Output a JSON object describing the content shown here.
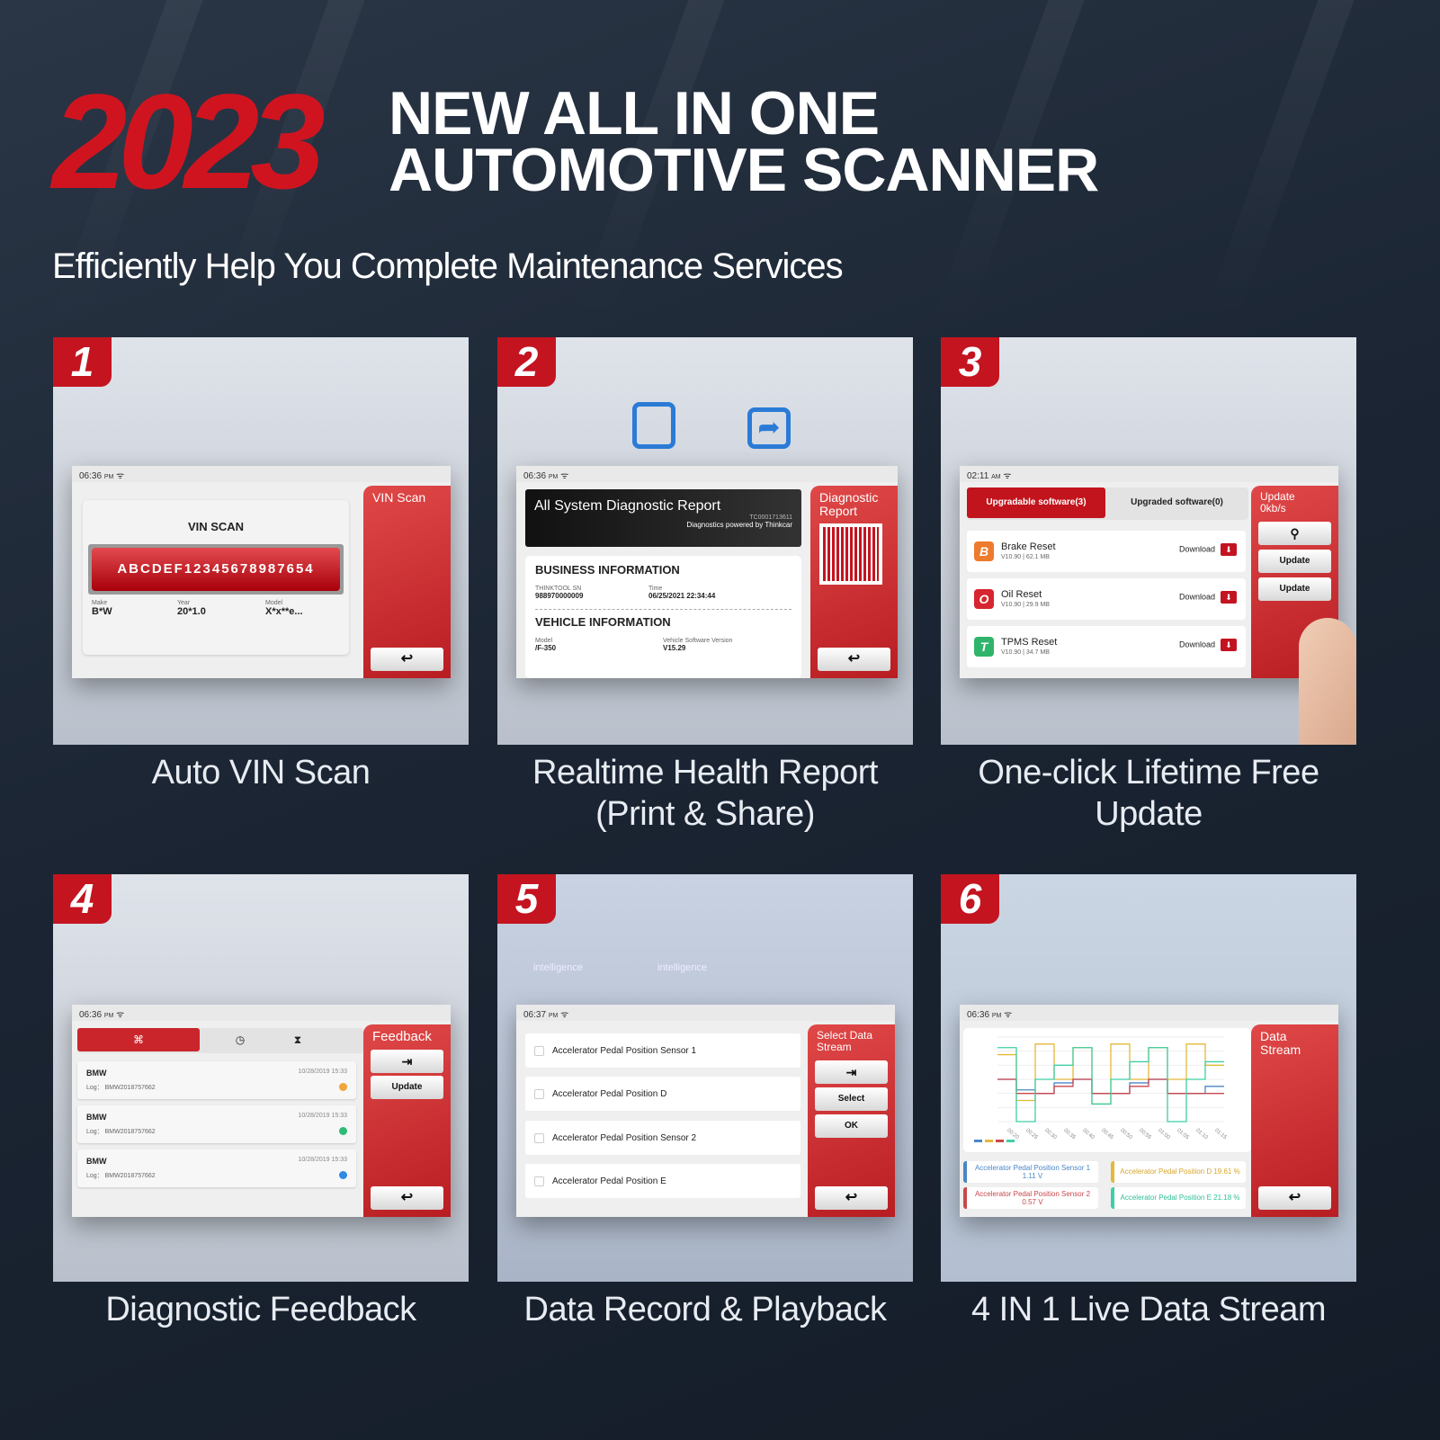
{
  "header": {
    "year": "2023",
    "line1": "NEW ALL IN ONE",
    "line2": "AUTOMOTIVE SCANNER",
    "subtitle": "Efficiently Help You Complete Maintenance Services"
  },
  "colors": {
    "brand_red": "#c41420",
    "background": "#1b2533"
  },
  "features": [
    {
      "number": "1",
      "caption": "Auto VIN Scan"
    },
    {
      "number": "2",
      "caption_line1": "Realtime Health Report",
      "caption_line2": "(Print & Share)"
    },
    {
      "number": "3",
      "caption_line1": "One-click Lifetime Free",
      "caption_line2": "Update"
    },
    {
      "number": "4",
      "caption": "Diagnostic Feedback"
    },
    {
      "number": "5",
      "caption": "Data Record & Playback"
    },
    {
      "number": "6",
      "caption": "4 IN 1 Live Data Stream"
    }
  ],
  "screen1": {
    "time": "06:36",
    "ampm": "PM",
    "title": "VIN SCAN",
    "vin": "ABCDEF12345678987654",
    "make_label": "Make",
    "make": "B*W",
    "year_label": "Year",
    "year": "20*1.0",
    "model_label": "Model",
    "model": "X*x**e...",
    "side_title": "VIN Scan",
    "back_icon": "back-arrow-icon"
  },
  "screen2": {
    "time": "06:36",
    "ampm": "PM",
    "report_title": "All System Diagnostic Report",
    "report_id": "TC0001713611",
    "powered": "Diagnostics powered by Thinkcar",
    "business_heading": "BUSINESS INFORMATION",
    "sn_label": "THINKTOOL SN",
    "sn": "988970000009",
    "time_label": "Time",
    "report_time": "06/25/2021 22:34:44",
    "vehicle_heading": "VEHICLE INFORMATION",
    "model_label": "Model",
    "model": "/F-350",
    "version_label": "Vehicle Software Version",
    "version": "V15.29",
    "side_title": "Diagnostic Report",
    "icons": [
      "printer-icon",
      "share-icon",
      "qr-code-icon"
    ]
  },
  "screen3": {
    "time": "02:11",
    "ampm": "AM",
    "tab_active": "Upgradable software(3)",
    "tab_other": "Upgraded software(0)",
    "side_title": "Update",
    "speed": "0kb/s",
    "search_icon": "search-icon",
    "update_btn": "Update",
    "update_btn2": "Update",
    "items": [
      {
        "letter": "B",
        "name": "Brake Reset",
        "meta": "V10.90 | 62.1 MB",
        "action": "Download",
        "color": "#ee7a2e"
      },
      {
        "letter": "O",
        "name": "Oil Reset",
        "meta": "V10.90 | 29.9 MB",
        "action": "Download",
        "color": "#d6252f"
      },
      {
        "letter": "T",
        "name": "TPMS Reset",
        "meta": "V10.90 | 34.7 MB",
        "action": "Download",
        "color": "#2fb56b"
      }
    ]
  },
  "screen4": {
    "time": "06:36",
    "ampm": "PM",
    "side_title": "Feedback",
    "update_btn": "Update",
    "tabs": [
      "grid-icon",
      "clock-icon",
      "hourglass-icon"
    ],
    "items": [
      {
        "make": "BMW",
        "log": "Log： BMW2018757662",
        "date": "10/28/2019 15:33",
        "status_color": "#f0a53a"
      },
      {
        "make": "BMW",
        "log": "Log： BMW2018757662",
        "date": "10/28/2019 15:33",
        "status_color": "#2dbb78"
      },
      {
        "make": "BMW",
        "log": "Log： BMW2018757662",
        "date": "10/28/2019 15:33",
        "status_color": "#2f8ae5"
      }
    ]
  },
  "screen5": {
    "time": "06:37",
    "ampm": "PM",
    "bg_text": "intelligence",
    "side_title": "Select Data Stream",
    "select_btn": "Select",
    "ok_btn": "OK",
    "items": [
      "Accelerator Pedal Position Sensor 1",
      "Accelerator Pedal Position D",
      "Accelerator Pedal Position Sensor 2",
      "Accelerator Pedal Position E"
    ]
  },
  "screen6": {
    "time": "06:36",
    "ampm": "PM",
    "side_title": "Data Stream",
    "legend": [
      {
        "label": "Accelerator Pedal Position Sensor 1",
        "value": "1.11 V",
        "color": "#4a86c8"
      },
      {
        "label": "Accelerator Pedal Position D 19.61 %",
        "value": "",
        "color": "#e5b83a"
      },
      {
        "label": "Accelerator Pedal Position Sensor 2",
        "value": "0.57 V",
        "color": "#c9474c"
      },
      {
        "label": "Accelerator Pedal Position E 21.18 %",
        "value": "",
        "color": "#3fcfa6"
      }
    ]
  },
  "chart_data": {
    "type": "line",
    "x": [
      "00:20",
      "00:25",
      "00:30",
      "00:35",
      "00:40",
      "00:45",
      "00:50",
      "00:55",
      "01:00",
      "01:05",
      "01:10",
      "01:15"
    ],
    "ylim_left": [
      0,
      2.4
    ],
    "ylim_right": [
      0,
      1.2
    ],
    "grid": true,
    "series": [
      {
        "color": "#4a86c8",
        "values": [
          1.2,
          0.9,
          0.8,
          1.1,
          1.2,
          0.8,
          0.8,
          1.1,
          1.2,
          0.8,
          0.8,
          1.0
        ]
      },
      {
        "color": "#e5b83a",
        "values": [
          1.9,
          0.6,
          2.2,
          1.2,
          2.1,
          0.5,
          2.2,
          1.2,
          2.1,
          1.2,
          2.2,
          1.6
        ]
      },
      {
        "color": "#c9474c",
        "values": [
          1.2,
          0.8,
          0.8,
          1.0,
          1.2,
          0.8,
          0.8,
          1.0,
          1.2,
          0.8,
          0.8,
          0.8
        ]
      },
      {
        "color": "#3fcfa6",
        "values": [
          2.1,
          0.0,
          1.2,
          1.6,
          2.1,
          0.5,
          1.2,
          1.7,
          2.1,
          0.0,
          1.2,
          1.7
        ]
      }
    ]
  }
}
